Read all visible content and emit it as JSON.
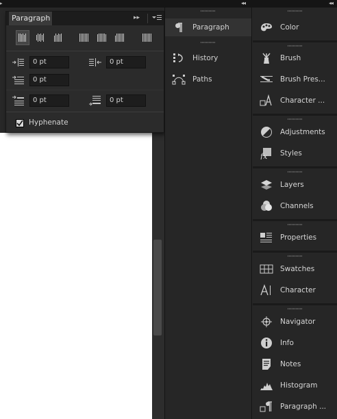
{
  "panel": {
    "tab_label": "Paragraph",
    "fields": {
      "left_indent": "0 pt",
      "right_indent": "0 pt",
      "first_line_indent": "0 pt",
      "space_before": "0 pt",
      "space_after": "0 pt"
    },
    "hyphenate_label": "Hyphenate",
    "hyphenate_checked": true
  },
  "middle_dock": {
    "items": [
      {
        "label": "Paragraph",
        "icon": "pilcrow-icon",
        "active": true
      },
      {
        "label": "History",
        "icon": "history-icon"
      },
      {
        "label": "Paths",
        "icon": "paths-icon"
      }
    ]
  },
  "right_dock": {
    "items": [
      {
        "label": "Color",
        "icon": "color-palette-icon"
      },
      {
        "label": "Brush",
        "icon": "brush-icon"
      },
      {
        "label": "Brush Pres...",
        "icon": "brush-presets-icon"
      },
      {
        "label": "Character ...",
        "icon": "character-styles-icon"
      },
      {
        "label": "Adjustments",
        "icon": "adjustments-icon"
      },
      {
        "label": "Styles",
        "icon": "styles-fx-icon"
      },
      {
        "label": "Layers",
        "icon": "layers-icon"
      },
      {
        "label": "Channels",
        "icon": "channels-icon"
      },
      {
        "label": "Properties",
        "icon": "properties-icon"
      },
      {
        "label": "Swatches",
        "icon": "swatches-icon"
      },
      {
        "label": "Character",
        "icon": "character-icon"
      },
      {
        "label": "Navigator",
        "icon": "navigator-icon"
      },
      {
        "label": "Info",
        "icon": "info-icon"
      },
      {
        "label": "Notes",
        "icon": "notes-icon"
      },
      {
        "label": "Histogram",
        "icon": "histogram-icon"
      },
      {
        "label": "Paragraph ...",
        "icon": "paragraph-styles-icon"
      }
    ]
  },
  "colors": {
    "panel_bg": "#2b2b2b",
    "dock_bg": "#262626",
    "field_bg": "#1d1d1d",
    "text": "#d2d2d2",
    "canvas": "#ffffff"
  }
}
